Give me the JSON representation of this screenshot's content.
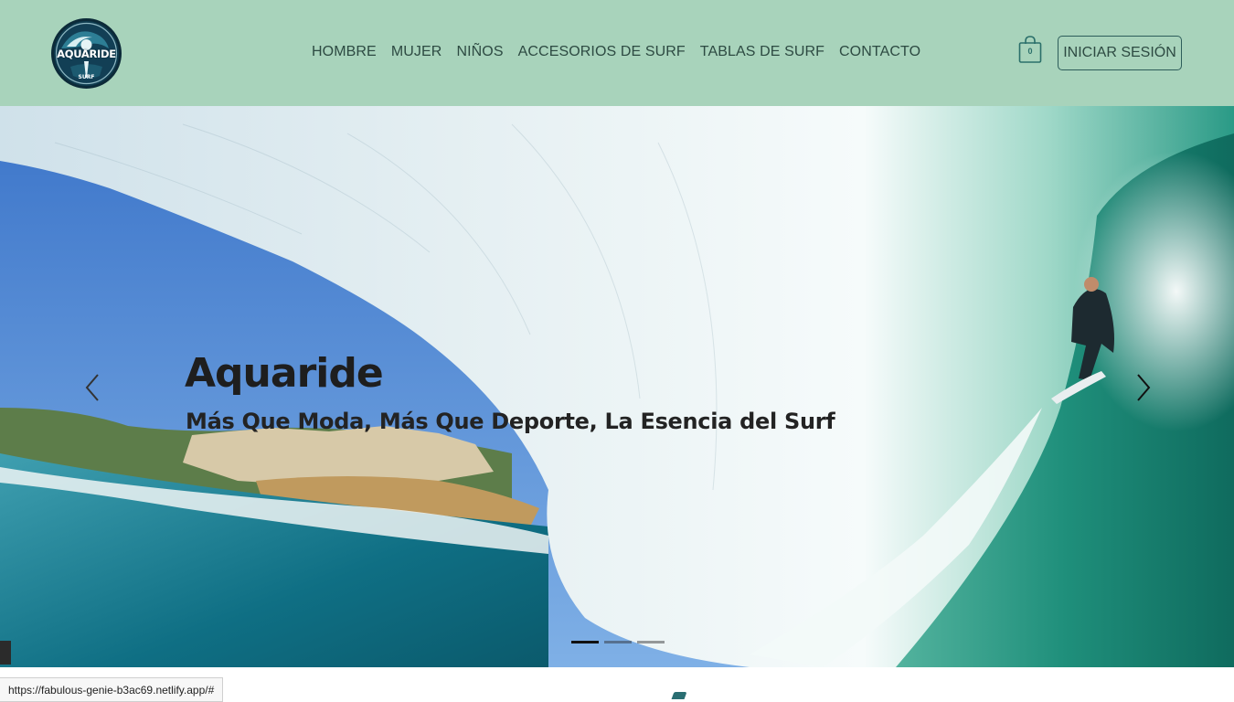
{
  "brand": {
    "logo_text": "AQUARIDE",
    "logo_subtext": "SURF",
    "colors": {
      "header_bg": "#a8d3bb",
      "logo_bg": "#0f3b4e",
      "nav_text": "#2d4a42"
    }
  },
  "nav": {
    "items": [
      {
        "label": "HOMBRE"
      },
      {
        "label": "MUJER"
      },
      {
        "label": "NIÑOS"
      },
      {
        "label": "ACCESORIOS DE SURF"
      },
      {
        "label": "TABLAS DE SURF"
      },
      {
        "label": "CONTACTO"
      }
    ]
  },
  "cart": {
    "count": "0",
    "icon": "shopping-bag-icon"
  },
  "auth": {
    "login_label": "INICIAR SESIÓN"
  },
  "hero": {
    "title": "Aquaride",
    "subtitle": "Más Que Moda, Más Que Deporte, La Esencia del Surf",
    "prev_icon": "chevron-left-icon",
    "next_icon": "chevron-right-icon",
    "slides": [
      {
        "active": true
      },
      {
        "active": false
      },
      {
        "active": false
      }
    ]
  },
  "status_bar": {
    "url": "https://fabulous-genie-b3ac69.netlify.app/#"
  }
}
